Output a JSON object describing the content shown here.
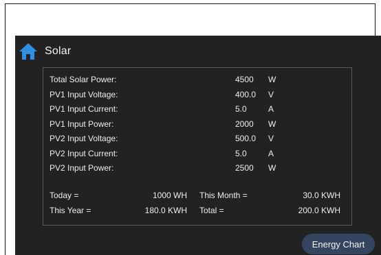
{
  "header": {
    "title": "Solar",
    "home_icon": "home-icon"
  },
  "colors": {
    "background": "#222222",
    "accent": "#2f8ee0",
    "button": "#34465f"
  },
  "readings": [
    {
      "label": "Total Solar Power:",
      "value": "4500",
      "unit": "W"
    },
    {
      "label": "PV1 Input Voltage:",
      "value": "400.0",
      "unit": "V"
    },
    {
      "label": "PV1 Input Current:",
      "value": "5.0",
      "unit": "A"
    },
    {
      "label": "PV1 Input Power:",
      "value": "2000",
      "unit": "W"
    },
    {
      "label": "PV2 Input Voltage:",
      "value": "500.0",
      "unit": "V"
    },
    {
      "label": "PV2 Input Current:",
      "value": "5.0",
      "unit": "A"
    },
    {
      "label": "PV2 Input Power:",
      "value": "2500",
      "unit": "W"
    }
  ],
  "summary": {
    "today_label": "Today =",
    "today_value": "1000 WH",
    "month_label": "This Month =",
    "month_value": "30.0 KWH",
    "year_label": "This Year =",
    "year_value": "180.0 KWH",
    "total_label": "Total =",
    "total_value": "200.0 KWH"
  },
  "energy_chart_button": "Energy Chart"
}
